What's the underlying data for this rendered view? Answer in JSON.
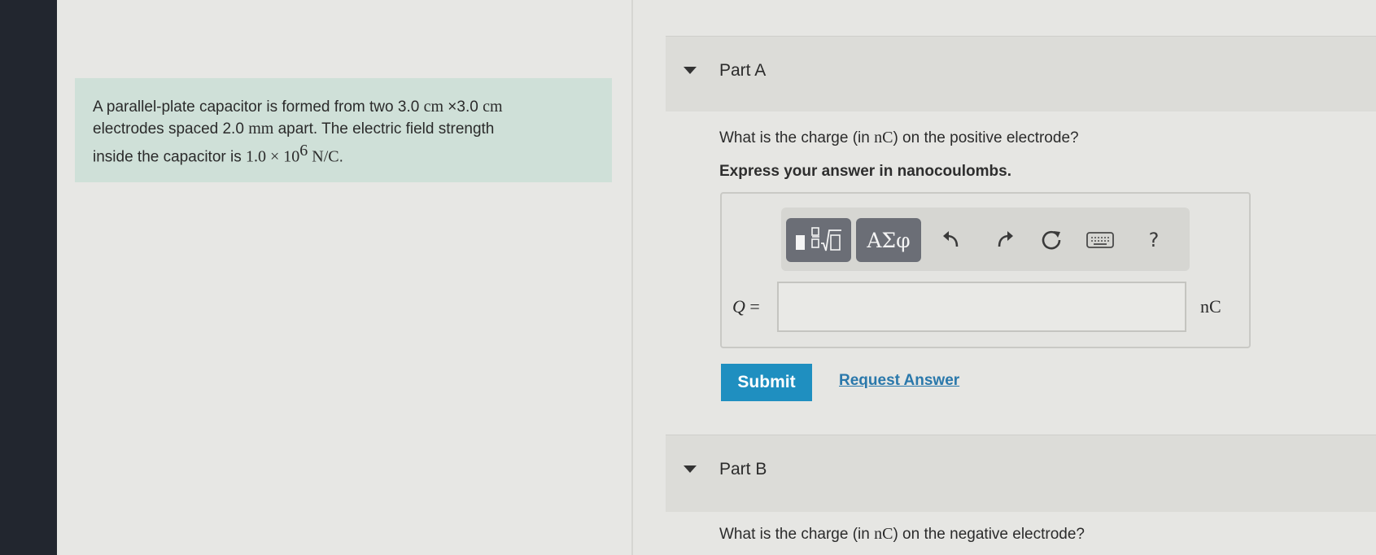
{
  "problem": {
    "statement": {
      "line1_prefix": "A parallel-plate capacitor is formed from two 3.0 ",
      "line1_unit1": "cm",
      "line1_mid": " ×3.0 ",
      "line1_unit2": "cm",
      "line2_prefix": "electrodes spaced 2.0 ",
      "line2_unit": "mm",
      "line2_suffix": " apart. The electric field strength",
      "line3_prefix": "inside the capacitor is ",
      "line3_value": "1.0 × 10",
      "line3_exp": "6",
      "line3_unit": " N/C",
      "line3_suffix": "."
    }
  },
  "part_a": {
    "title": "Part A",
    "question_prefix": "What is the charge (in ",
    "question_unit": "nC",
    "question_suffix": ") on the positive electrode?",
    "instruction": "Express your answer in nanocoulombs.",
    "toolbar": {
      "templates_icon": "templates-icon",
      "symbols_label": "ΑΣφ",
      "undo_icon": "undo-icon",
      "redo_icon": "redo-icon",
      "reset_icon": "reset-icon",
      "keyboard_icon": "keyboard-icon",
      "help_label": "?"
    },
    "variable": "Q",
    "equals": " =",
    "answer_value": "",
    "unit": "nC",
    "submit_label": "Submit",
    "request_answer_label": "Request Answer"
  },
  "part_b": {
    "title": "Part B",
    "question_prefix": "What is the charge (in ",
    "question_unit": "nC",
    "question_suffix": ") on the negative electrode?"
  },
  "colors": {
    "submit_bg": "#1f8fc0",
    "link": "#2a78ab",
    "problem_bg": "#cfe0d8",
    "toolbar_button": "#6b6e76"
  }
}
